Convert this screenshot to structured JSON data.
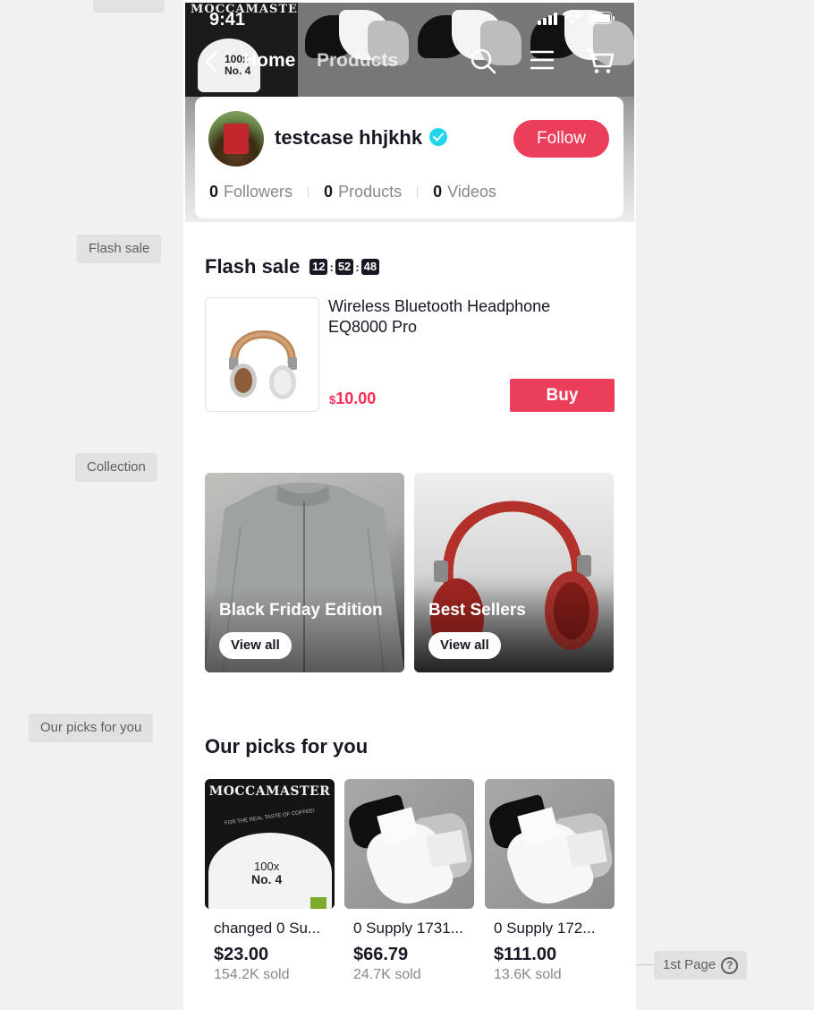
{
  "annotations": {
    "flash_sale": "Flash sale",
    "collection": "Collection",
    "picks": "Our picks for you",
    "page": "1st Page"
  },
  "status_bar": {
    "time": "9:41"
  },
  "nav": {
    "home": "Home",
    "products": "Products"
  },
  "hero_pack": {
    "brand": "MOCCAMASTER",
    "num": "100x",
    "no": "No. 4"
  },
  "shop": {
    "name": "testcase hhjkhk",
    "follow_label": "Follow",
    "followers_count": "0",
    "followers_label": "Followers",
    "products_count": "0",
    "products_label": "Products",
    "videos_count": "0",
    "videos_label": "Videos"
  },
  "flash_sale": {
    "title": "Flash sale",
    "timer": {
      "h": "12",
      "m": "52",
      "s": "48"
    },
    "product": {
      "name": "Wireless Bluetooth Headphone EQ8000 Pro",
      "currency": "$",
      "price": "10.00",
      "buy_label": "Buy"
    }
  },
  "collections": [
    {
      "title": "Black Friday Edition",
      "cta": "View all"
    },
    {
      "title": "Best Sellers",
      "cta": "View all"
    }
  ],
  "picks": {
    "title": "Our picks for you",
    "items": [
      {
        "name": "changed 0 Su...",
        "price": "$23.00",
        "sold": "154.2K sold",
        "pack_brand": "MOCCAMASTER",
        "pack_slogan": "FOR THE REAL TASTE OF COFFEE!",
        "pack_num": "100x",
        "pack_no": "No. 4"
      },
      {
        "name": "0 Supply 1731...",
        "price": "$66.79",
        "sold": "24.7K sold"
      },
      {
        "name": "0 Supply 172...",
        "price": "$111.00",
        "sold": "13.6K sold"
      }
    ]
  },
  "colors": {
    "accent": "#ea3e5a",
    "price": "#fe2c55",
    "verified": "#20d5ec"
  }
}
